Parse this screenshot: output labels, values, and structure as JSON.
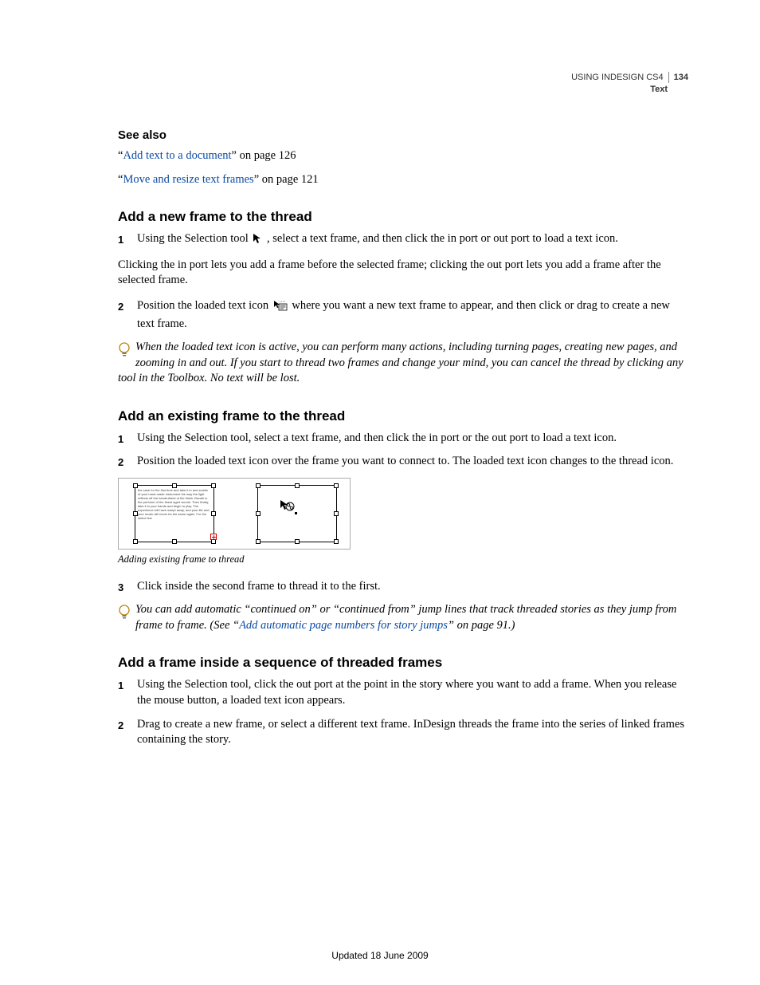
{
  "header": {
    "doc_title": "USING INDESIGN CS4",
    "section": "Text",
    "page_number": "134"
  },
  "see_also": {
    "heading": "See also",
    "items": [
      {
        "q1": "“",
        "link": "Add text to a document",
        "q2": "” on page 126"
      },
      {
        "q1": "“",
        "link": "Move and resize text frames",
        "q2": "” on page 121"
      }
    ]
  },
  "sec1": {
    "heading": "Add a new frame to the thread",
    "step1_pre": "Using the Selection tool ",
    "step1_post": " , select a text frame, and then click the in port or out port to load a text icon.",
    "para1": "Clicking the in port lets you add a frame before the selected frame; clicking the out port lets you add a frame after the selected frame.",
    "step2_pre": "Position the loaded text icon ",
    "step2_post": " where you want a new text frame to appear, and then click or drag to create a new text frame.",
    "tip": "When the loaded text icon is active, you can perform many actions, including turning pages, creating new pages, and zooming in and out. If you start to thread two frames and change your mind, you can cancel the thread by clicking any tool in the Toolbox. No text will be lost."
  },
  "sec2": {
    "heading": "Add an existing frame to the thread",
    "step1": "Using the Selection tool, select a text frame, and then click the in port or the out port to load a text icon.",
    "step2": "Position the loaded text icon over the frame you want to connect to. The loaded text icon changes to the thread icon.",
    "fig_caption": "Adding existing frame to thread",
    "step3": "Click inside the second frame to thread it to the first.",
    "tip_pre": "You can add automatic “continued on” or “continued from” jump lines that track threaded stories as they jump from frame to frame. (See “",
    "tip_link": "Add automatic page numbers for story jumps",
    "tip_post": "” on page 91.)"
  },
  "sec3": {
    "heading": "Add a frame inside a sequence of threaded frames",
    "step1": "Using the Selection tool, click the out port at the point in the story where you want to add a frame. When you release the mouse button, a loaded text icon appears.",
    "step2": "Drag to create a new frame, or select a different text frame. InDesign threads the frame into the series of linked frames containing the story."
  },
  "footer": "Updated 18 June 2009",
  "nums": {
    "n1": "1",
    "n2": "2",
    "n3": "3"
  },
  "fig_text": "the case for the first time and take it in and smells of your hand-made instrument the way the light reflects off the handrubbed of the finish. Breath in the perfume of the finest aged woods. Then finally, take it in your hands and begin to play. The experience will have swept away, and your life and your music will never be the same again. For the select few"
}
